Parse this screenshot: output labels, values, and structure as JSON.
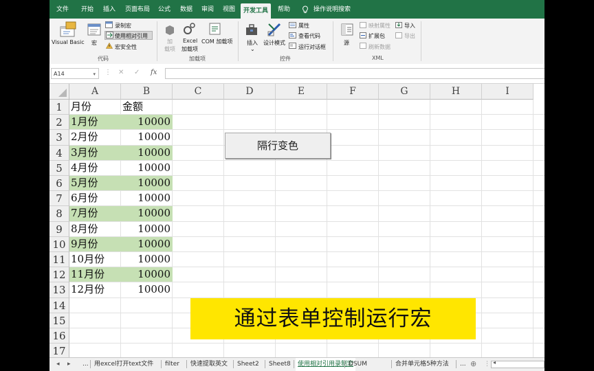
{
  "ribbon_tabs": [
    "文件",
    "开始",
    "插入",
    "页面布局",
    "公式",
    "数据",
    "审阅",
    "视图",
    "开发工具",
    "帮助",
    "操作说明搜索"
  ],
  "active_tab": "开发工具",
  "ribbon": {
    "code": {
      "visual_basic": "Visual Basic",
      "macros": "宏",
      "record_macro": "录制宏",
      "relative_refs": "使用相对引用",
      "macro_security": "宏安全性",
      "label": "代码"
    },
    "addins": {
      "add_ins_l1": "加",
      "add_ins_l2": "载项",
      "excel_addins_l1": "Excel",
      "excel_addins_l2": "加载项",
      "com_addins": "COM 加载项",
      "label": "加载项"
    },
    "controls": {
      "insert": "插入",
      "design_mode": "设计模式",
      "properties": "属性",
      "view_code": "查看代码",
      "run_dialog": "运行对话框",
      "label": "控件"
    },
    "xml": {
      "source": "源",
      "map_properties": "映射属性",
      "expansion_packs": "扩展包",
      "refresh_data": "刷新数据",
      "import": "导入",
      "export": "导出",
      "label": "XML"
    }
  },
  "formula_bar": {
    "name_box": "A14",
    "fx": "fx",
    "value": ""
  },
  "columns": [
    "A",
    "B",
    "C",
    "D",
    "E",
    "F",
    "G",
    "H",
    "I"
  ],
  "rows": [
    "1",
    "2",
    "3",
    "4",
    "5",
    "6",
    "7",
    "8",
    "9",
    "10",
    "11",
    "12",
    "13",
    "14",
    "15",
    "16",
    "17"
  ],
  "table": {
    "header_a": "月份",
    "header_b": "金额",
    "data": [
      {
        "month": "1月份",
        "amount": "10000",
        "shaded": true
      },
      {
        "month": "2月份",
        "amount": "10000",
        "shaded": false
      },
      {
        "month": "3月份",
        "amount": "10000",
        "shaded": true
      },
      {
        "month": "4月份",
        "amount": "10000",
        "shaded": false
      },
      {
        "month": "5月份",
        "amount": "10000",
        "shaded": true
      },
      {
        "month": "6月份",
        "amount": "10000",
        "shaded": false
      },
      {
        "month": "7月份",
        "amount": "10000",
        "shaded": true
      },
      {
        "month": "8月份",
        "amount": "10000",
        "shaded": false
      },
      {
        "month": "9月份",
        "amount": "10000",
        "shaded": true
      },
      {
        "month": "10月份",
        "amount": "10000",
        "shaded": false
      },
      {
        "month": "11月份",
        "amount": "10000",
        "shaded": true
      },
      {
        "month": "12月份",
        "amount": "10000",
        "shaded": false
      }
    ]
  },
  "form_button": "隔行变色",
  "caption": "通过表单控制运行宏",
  "sheet_tabs": [
    "...",
    "用excel打开text文件",
    "filter",
    "快速提取英文",
    "Sheet2",
    "Sheet8",
    "使用相对引用录制宏",
    "DSUM",
    "合并单元格5种方法",
    "..."
  ],
  "active_sheet": "使用相对引用录制宏",
  "colors": {
    "ribbon_green": "#217346",
    "row_shade": "#c6e0b4",
    "caption_bg": "#ffe600"
  }
}
